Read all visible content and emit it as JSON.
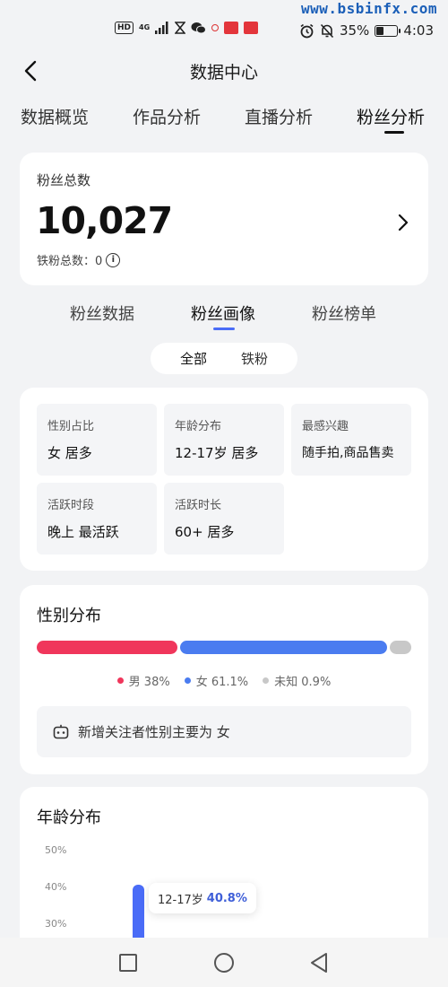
{
  "status_bar": {
    "network": "4G",
    "watermark": "www.bsbinfx.com",
    "battery_text": "35%",
    "battery_level": 0.35,
    "time": "4:03"
  },
  "header": {
    "title": "数据中心"
  },
  "top_tabs": [
    {
      "label": "数据概览",
      "active": false
    },
    {
      "label": "作品分析",
      "active": false
    },
    {
      "label": "直播分析",
      "active": false
    },
    {
      "label": "粉丝分析",
      "active": true
    }
  ],
  "fans_summary": {
    "label": "粉丝总数",
    "count": "10,027",
    "iron_label": "铁粉总数：0"
  },
  "sub_tabs": [
    {
      "label": "粉丝数据",
      "active": false
    },
    {
      "label": "粉丝画像",
      "active": true
    },
    {
      "label": "粉丝榜单",
      "active": false
    }
  ],
  "filter_toggle": {
    "options": [
      "全部",
      "铁粉"
    ],
    "selected": "全部"
  },
  "portrait": {
    "tiles": [
      {
        "label": "性别占比",
        "value": "女 居多"
      },
      {
        "label": "年龄分布",
        "value": "12-17岁 居多"
      },
      {
        "label": "最感兴趣",
        "value": "随手拍,商品售卖"
      },
      {
        "label": "活跃时段",
        "value": "晚上 最活跃"
      },
      {
        "label": "活跃时长",
        "value": "60+ 居多"
      }
    ]
  },
  "gender": {
    "title": "性别分布",
    "segments": [
      {
        "name": "男",
        "percent": 38,
        "label": "男 38%",
        "color": "#f0365b"
      },
      {
        "name": "女",
        "percent": 61.1,
        "label": "女 61.1%",
        "color": "#4a7cf0"
      },
      {
        "name": "未知",
        "percent": 0.9,
        "label": "未知 0.9%",
        "color": "#c8c8c8"
      }
    ],
    "note": "新增关注者性别主要为 女"
  },
  "age": {
    "title": "年龄分布",
    "y_ticks": [
      "50%",
      "40%",
      "30%"
    ],
    "tooltip_label": "12-17岁",
    "tooltip_value": "40.8%",
    "bar_color": "#4a6cf7"
  },
  "chart_data": {
    "type": "bar",
    "title": "年龄分布",
    "categories": [
      "12-17岁"
    ],
    "values": [
      40.8
    ],
    "ylim": [
      0,
      50
    ],
    "y_ticks": [
      30,
      40,
      50
    ]
  }
}
